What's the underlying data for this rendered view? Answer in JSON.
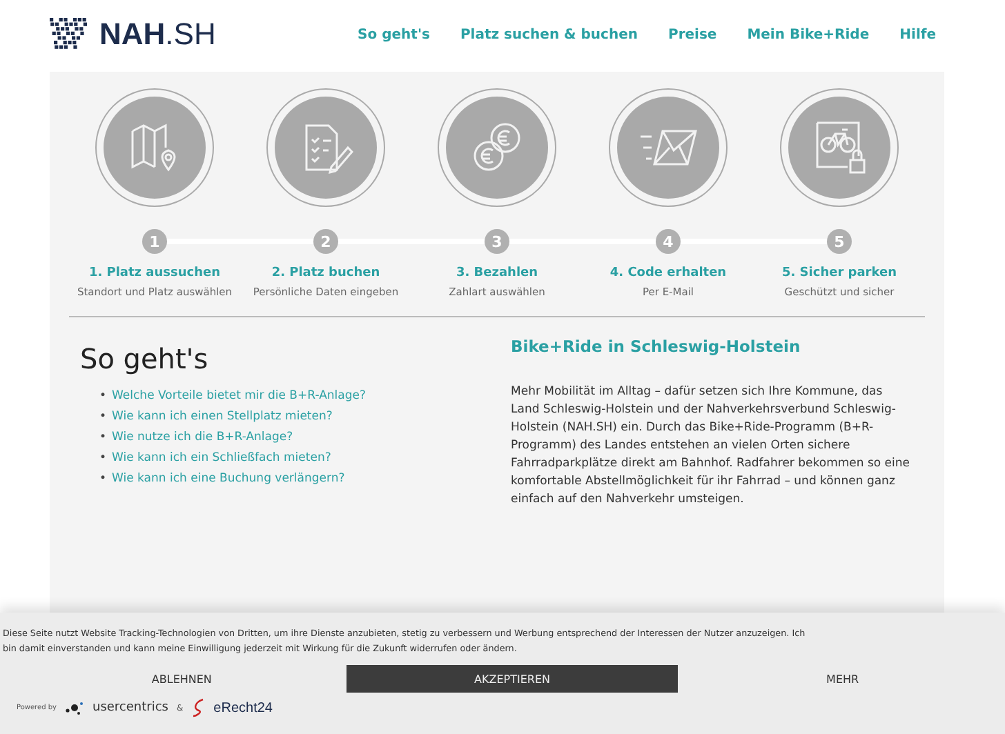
{
  "header": {
    "logo": "NAH",
    "logo_suffix": ".SH",
    "nav": [
      {
        "label": "So geht's"
      },
      {
        "label": "Platz suchen & buchen"
      },
      {
        "label": "Preise"
      },
      {
        "label": "Mein Bike+Ride"
      },
      {
        "label": "Hilfe"
      }
    ]
  },
  "steps": [
    {
      "kind": "map",
      "number": "1",
      "title": "1. Platz aussuchen",
      "description": "Standort und Platz auswählen"
    },
    {
      "kind": "checklist",
      "number": "2",
      "title": "2. Platz buchen",
      "description": "Persönliche Daten eingeben"
    },
    {
      "kind": "coins",
      "number": "3",
      "title": "3. Bezahlen",
      "description": "Zahlart auswählen"
    },
    {
      "kind": "mail",
      "number": "4",
      "title": "4. Code erhalten",
      "description": "Per E-Mail"
    },
    {
      "kind": "bike",
      "number": "5",
      "title": "5. Sicher parken",
      "description": "Geschützt und sicher"
    }
  ],
  "faq": {
    "heading": "So geht's",
    "links": [
      {
        "marker": "•",
        "label": "Welche Vorteile bietet mir die B+R-Anlage?"
      },
      {
        "marker": "•",
        "label": "Wie kann ich einen Stellplatz mieten?"
      },
      {
        "marker": "•",
        "label": "Wie nutze ich die B+R-Anlage?"
      },
      {
        "marker": "•",
        "label": "Wie kann ich ein Schließfach mieten?"
      },
      {
        "marker": "•",
        "label": "Wie kann ich eine Buchung verlängern?"
      }
    ]
  },
  "intro": {
    "heading": "Bike+Ride in Schleswig-Holstein",
    "text": "Mehr Mobilität im Alltag – dafür setzen sich Ihre Kommune, das Land Schleswig-Holstein und der Nahverkehrsverbund Schleswig-Holstein (NAH.SH) ein. Durch das Bike+Ride-Programm (B+R-Programm) des Landes entstehen an vielen Orten sichere Fahrradparkplätze direkt am Bahnhof. Radfahrer bekommen so eine komfortable Abstellmöglichkeit für ihr Fahrrad – und können ganz einfach auf den Nahverkehr umsteigen."
  },
  "cookie_banner": {
    "lines": [
      "Diese Seite nutzt Website Tracking-Technologien von Dritten, um ihre Dienste anzubieten, stetig zu verbessern und Werbung entsprechend der Interessen der Nutzer anzuzeigen. Ich",
      "bin damit einverstanden und kann meine Einwilligung jederzeit mit Wirkung für die Zukunft widerrufen oder ändern."
    ],
    "buttons": [
      {
        "label": "ABLEHNEN",
        "kind": "plain"
      },
      {
        "label": "AKZEPTIEREN",
        "kind": "primary"
      },
      {
        "label": "MEHR",
        "kind": "plain"
      }
    ],
    "powered_by": "Powered by",
    "brand_1": "usercentrics",
    "separator": "&",
    "brand_2": "eRecht24"
  }
}
